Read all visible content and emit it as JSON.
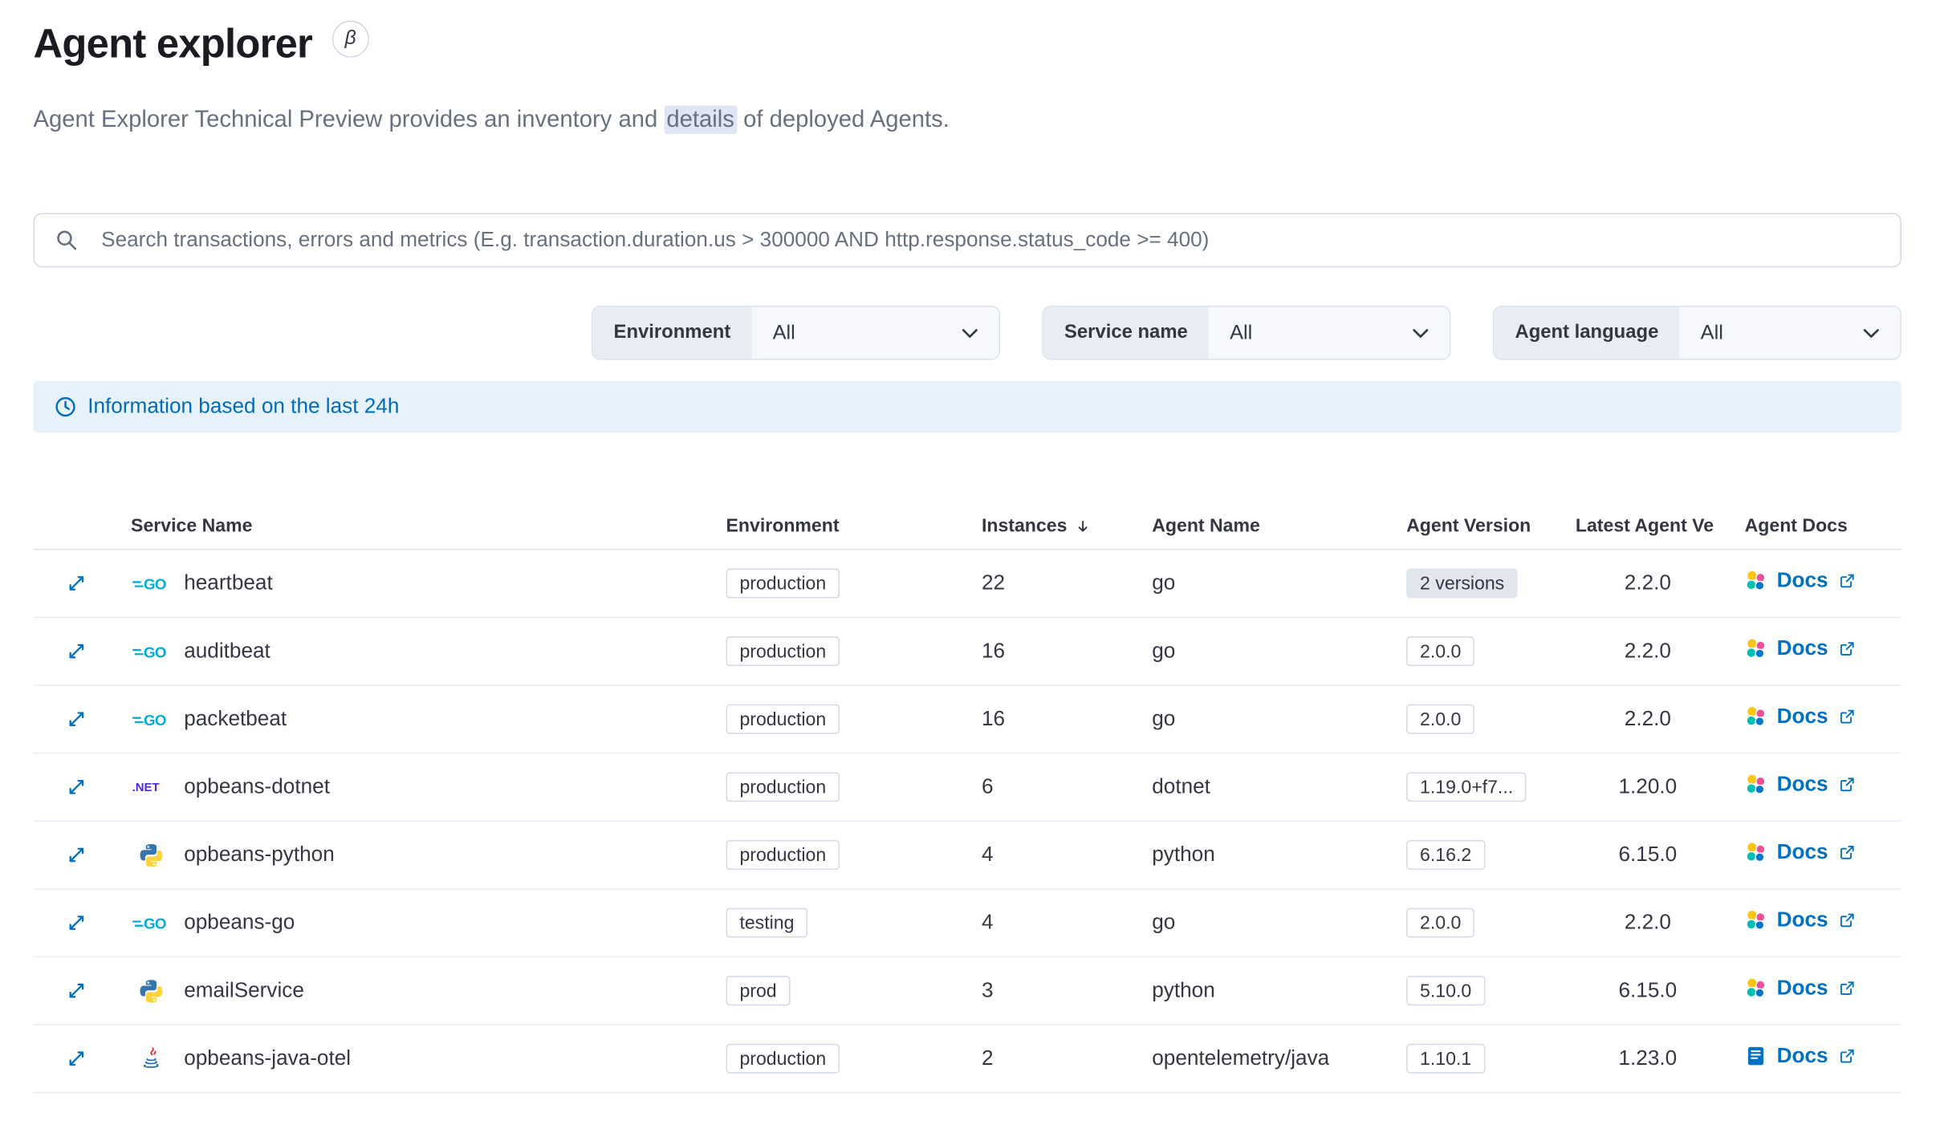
{
  "page": {
    "title": "Agent explorer",
    "beta_badge": "β",
    "subtitle_prefix": "Agent Explorer Technical Preview provides an inventory and ",
    "subtitle_highlight": "details",
    "subtitle_suffix": " of deployed Agents."
  },
  "search": {
    "placeholder": "Search transactions, errors and metrics (E.g. transaction.duration.us > 300000 AND http.response.status_code >= 400)"
  },
  "filters": {
    "environment": {
      "label": "Environment",
      "value": "All"
    },
    "service_name": {
      "label": "Service name",
      "value": "All"
    },
    "agent_language": {
      "label": "Agent language",
      "value": "All"
    }
  },
  "banner": {
    "text": "Information based on the last 24h"
  },
  "table": {
    "headers": {
      "service_name": "Service Name",
      "environment": "Environment",
      "instances": "Instances",
      "agent_name": "Agent Name",
      "agent_version": "Agent Version",
      "latest_agent_version": "Latest Agent Ve",
      "agent_docs": "Agent Docs"
    },
    "sort": {
      "column": "Instances",
      "direction": "desc"
    },
    "rows": [
      {
        "service": "heartbeat",
        "language_icon": "go",
        "environment": "production",
        "instances": "22",
        "agent_name": "go",
        "agent_version": "2 versions",
        "version_badge": "filled",
        "latest_version": "2.2.0",
        "docs_label": "Docs",
        "docs_icon": "elastic"
      },
      {
        "service": "auditbeat",
        "language_icon": "go",
        "environment": "production",
        "instances": "16",
        "agent_name": "go",
        "agent_version": "2.0.0",
        "version_badge": "outline",
        "latest_version": "2.2.0",
        "docs_label": "Docs",
        "docs_icon": "elastic"
      },
      {
        "service": "packetbeat",
        "language_icon": "go",
        "environment": "production",
        "instances": "16",
        "agent_name": "go",
        "agent_version": "2.0.0",
        "version_badge": "outline",
        "latest_version": "2.2.0",
        "docs_label": "Docs",
        "docs_icon": "elastic"
      },
      {
        "service": "opbeans-dotnet",
        "language_icon": "dotnet",
        "environment": "production",
        "instances": "6",
        "agent_name": "dotnet",
        "agent_version": "1.19.0+f7...",
        "version_badge": "outline",
        "latest_version": "1.20.0",
        "docs_label": "Docs",
        "docs_icon": "elastic"
      },
      {
        "service": "opbeans-python",
        "language_icon": "python",
        "environment": "production",
        "instances": "4",
        "agent_name": "python",
        "agent_version": "6.16.2",
        "version_badge": "outline",
        "latest_version": "6.15.0",
        "docs_label": "Docs",
        "docs_icon": "elastic"
      },
      {
        "service": "opbeans-go",
        "language_icon": "go",
        "environment": "testing",
        "instances": "4",
        "agent_name": "go",
        "agent_version": "2.0.0",
        "version_badge": "outline",
        "latest_version": "2.2.0",
        "docs_label": "Docs",
        "docs_icon": "elastic"
      },
      {
        "service": "emailService",
        "language_icon": "python",
        "environment": "prod",
        "instances": "3",
        "agent_name": "python",
        "agent_version": "5.10.0",
        "version_badge": "outline",
        "latest_version": "6.15.0",
        "docs_label": "Docs",
        "docs_icon": "elastic"
      },
      {
        "service": "opbeans-java-otel",
        "language_icon": "java",
        "environment": "production",
        "instances": "2",
        "agent_name": "opentelemetry/java",
        "agent_version": "1.10.1",
        "version_badge": "outline",
        "latest_version": "1.23.0",
        "docs_label": "Docs",
        "docs_icon": "book"
      }
    ]
  },
  "colors": {
    "primary": "#006bb8",
    "primary_link": "#0071c2",
    "text": "#343741",
    "subdued": "#69707d",
    "border": "#d3dae6",
    "banner_bg": "#e6f1fa",
    "badge_fill": "#e0e5ee",
    "filter_label_bg": "#e9edf3",
    "filter_value_bg": "#f6f8fc",
    "highlight_bg": "#dfe5f2",
    "go": "#00ADD8",
    "dotnet": "#5027d5"
  }
}
